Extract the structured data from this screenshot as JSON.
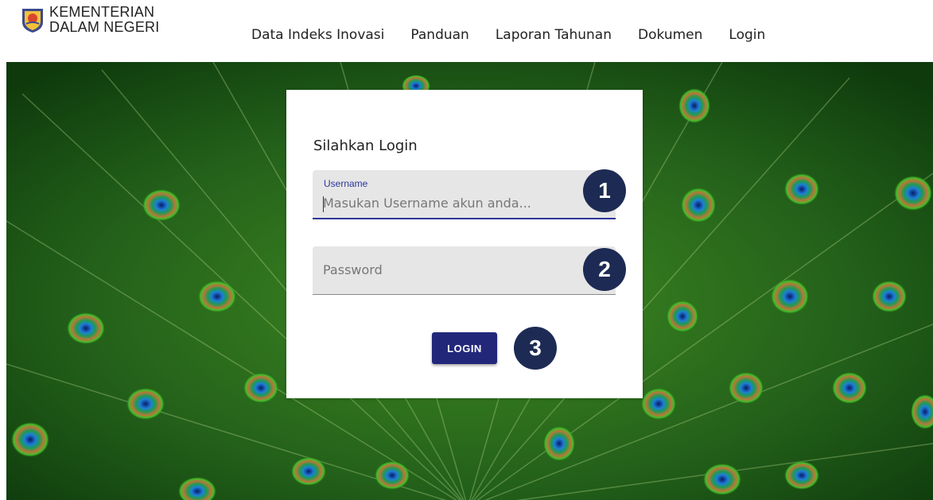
{
  "brand": {
    "line1": "KEMENTERIAN",
    "line2": "DALAM NEGERI"
  },
  "nav": {
    "items": [
      {
        "label": "Data Indeks Inovasi"
      },
      {
        "label": "Panduan"
      },
      {
        "label": "Laporan Tahunan"
      },
      {
        "label": "Dokumen"
      },
      {
        "label": "Login"
      }
    ]
  },
  "login": {
    "title": "Silahkan Login",
    "username_label": "Username",
    "username_placeholder": "Masukan Username akun anda...",
    "password_placeholder": "Password",
    "button_label": "LOGIN"
  },
  "badges": [
    "1",
    "2",
    "3"
  ],
  "colors": {
    "primary": "#22277a",
    "badge": "#1d2b54",
    "field_bg": "#e6e6e6"
  },
  "icons": {
    "logo": "kemendagri-emblem-icon"
  }
}
